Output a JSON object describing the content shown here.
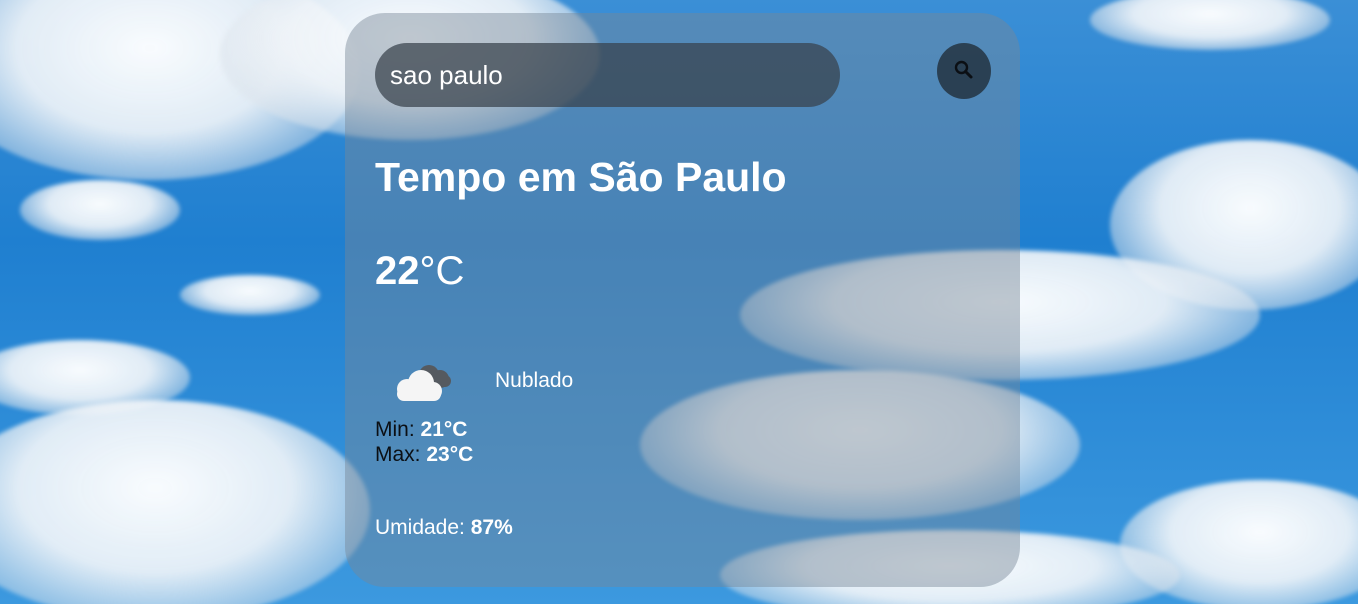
{
  "search": {
    "value": "sao paulo",
    "button_icon": "search-icon"
  },
  "weather": {
    "title": "Tempo em São Paulo",
    "temp_value": "22",
    "temp_unit": "°C",
    "icon": "cloudy-icon",
    "description": "Nublado",
    "min_label": "Min:",
    "min_value": "21°C",
    "max_label": "Max:",
    "max_value": "23°C",
    "humidity_label": "Umidade:",
    "humidity_value": "87%"
  },
  "colors": {
    "sky": "#1f7fd0",
    "card": "#78879673",
    "text": "#ffffff",
    "minmax_label": "#0b0f14"
  }
}
